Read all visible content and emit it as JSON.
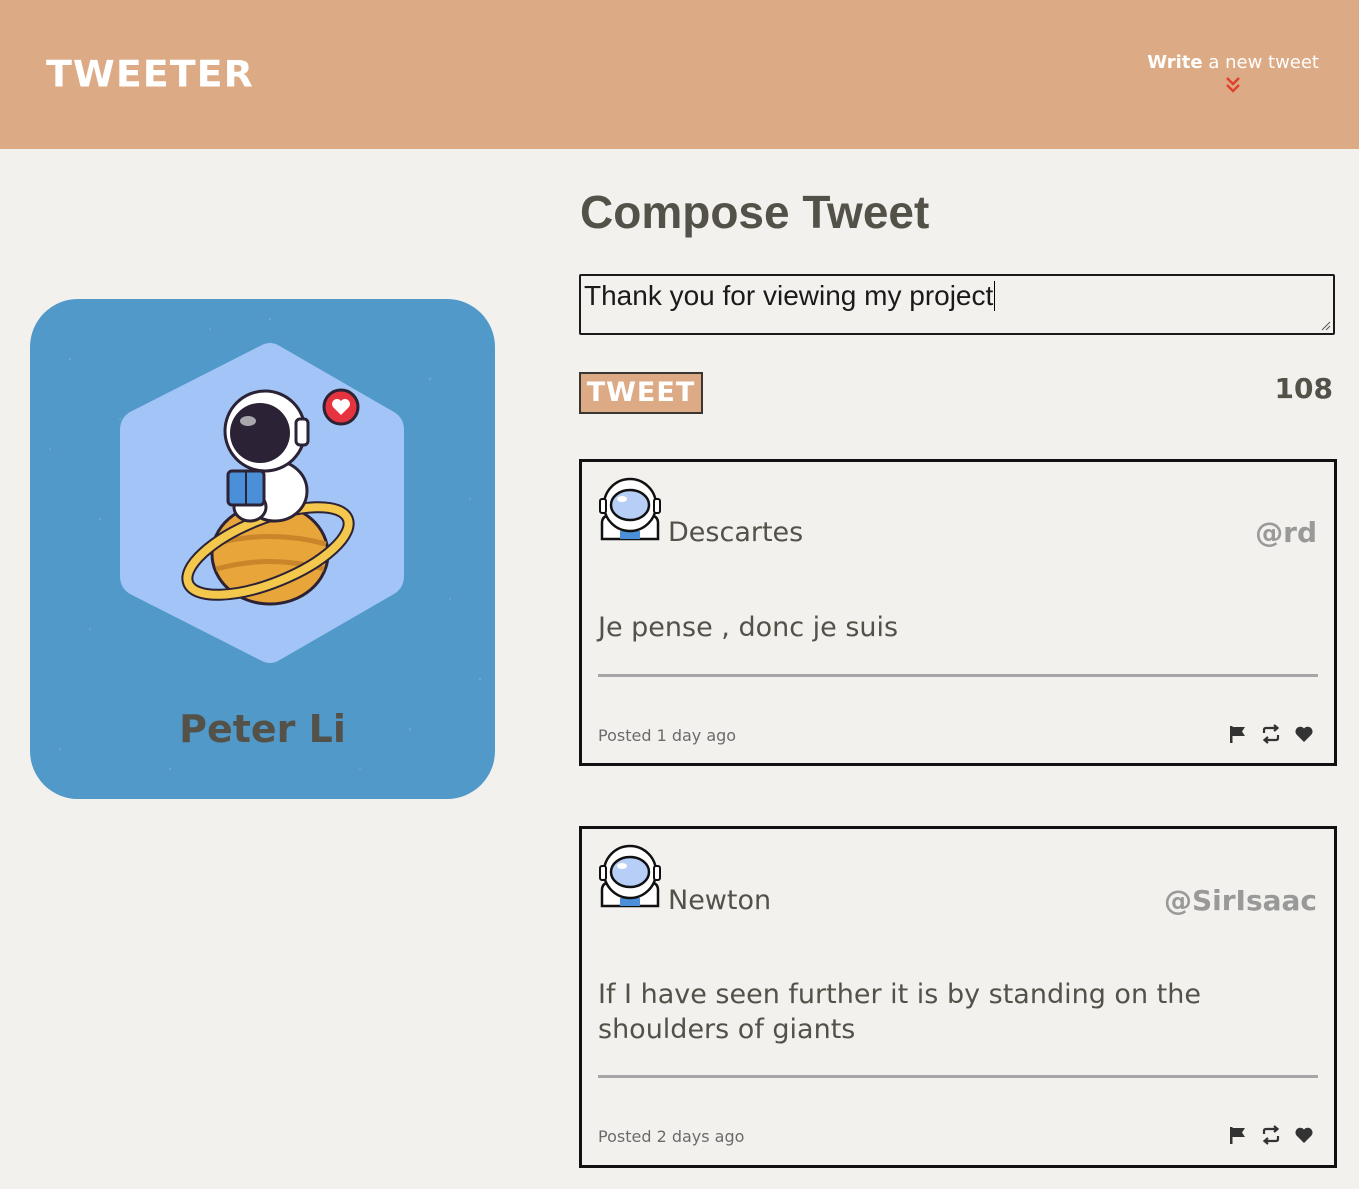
{
  "nav": {
    "brand": "TWEETER",
    "write_bold": "Write",
    "write_rest": " a new tweet",
    "chevron_icon": "double-chevron-down",
    "colors": {
      "bar": "#dcaa85",
      "chevron": "#e0412e"
    }
  },
  "profile": {
    "name": "Peter Li",
    "avatar_icon": "astronaut-reading-on-planet",
    "colors": {
      "card": "#5099c9",
      "hexagon": "#a2c4f6"
    }
  },
  "compose": {
    "title": "Compose Tweet",
    "text_value": "Thank you for viewing my project",
    "button_label": "TWEET",
    "counter": "108"
  },
  "tweets": [
    {
      "name": "Descartes",
      "handle": "@rd",
      "body": "Je pense , donc je suis",
      "posted": "Posted 1 day ago",
      "avatar_icon": "astronaut-helmet-icon",
      "actions": [
        "flag-icon",
        "retweet-icon",
        "heart-icon"
      ]
    },
    {
      "name": "Newton",
      "handle": "@SirIsaac",
      "body": "If I have seen further it is by standing on the shoulders of giants",
      "posted": "Posted 2 days ago",
      "avatar_icon": "astronaut-helmet-icon",
      "actions": [
        "flag-icon",
        "retweet-icon",
        "heart-icon"
      ]
    }
  ]
}
